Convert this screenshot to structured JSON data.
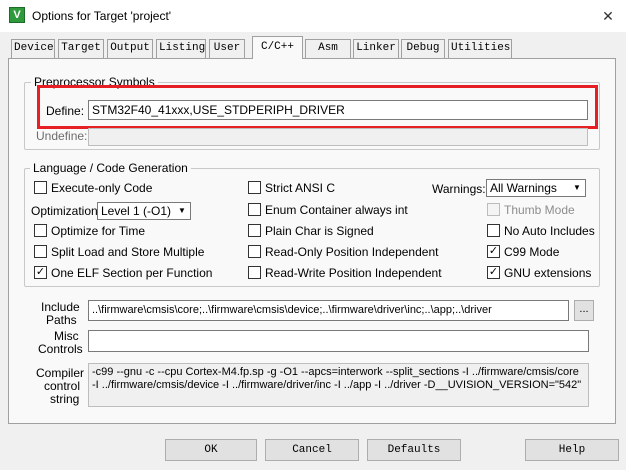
{
  "window": {
    "title": "Options for Target 'project'",
    "app_icon_glyph": "V",
    "close_glyph": "✕"
  },
  "tabs": [
    {
      "label": "Device"
    },
    {
      "label": "Target"
    },
    {
      "label": "Output"
    },
    {
      "label": "Listing"
    },
    {
      "label": "User"
    },
    {
      "label": "C/C++"
    },
    {
      "label": "Asm"
    },
    {
      "label": "Linker"
    },
    {
      "label": "Debug"
    },
    {
      "label": "Utilities"
    }
  ],
  "preprocessor": {
    "group_title": "Preprocessor Symbols",
    "define_label": "Define:",
    "define_value": "STM32F40_41xxx,USE_STDPERIPH_DRIVER",
    "undefine_label": "Undefine:",
    "undefine_value": ""
  },
  "codegen": {
    "group_title": "Language / Code Generation",
    "execute_only": {
      "label": "Execute-only Code",
      "checked": false
    },
    "optimization_label": "Optimization:",
    "optimization_value": "Level 1 (-O1)",
    "optimize_time": {
      "label": "Optimize for Time",
      "checked": false
    },
    "split_load": {
      "label": "Split Load and Store Multiple",
      "checked": false
    },
    "one_elf": {
      "label": "One ELF Section per Function",
      "checked": true
    },
    "strict_ansi": {
      "label": "Strict ANSI C",
      "checked": false
    },
    "enum_container": {
      "label": "Enum Container always int",
      "checked": false
    },
    "plain_char": {
      "label": "Plain Char is Signed",
      "checked": false
    },
    "ro_pi": {
      "label": "Read-Only Position Independent",
      "checked": false
    },
    "rw_pi": {
      "label": "Read-Write Position Independent",
      "checked": false
    },
    "warnings_label": "Warnings:",
    "warnings_value": "All Warnings",
    "thumb_mode": {
      "label": "Thumb Mode",
      "checked": false,
      "disabled": true
    },
    "no_auto_includes": {
      "label": "No Auto Includes",
      "checked": false
    },
    "c99_mode": {
      "label": "C99 Mode",
      "checked": true
    },
    "gnu_ext": {
      "label": "GNU extensions",
      "checked": true
    }
  },
  "paths": {
    "include_label_1": "Include",
    "include_label_2": "Paths",
    "include_value": "..\\firmware\\cmsis\\core;..\\firmware\\cmsis\\device;..\\firmware\\driver\\inc;..\\app;..\\driver",
    "browse_label": "...",
    "misc_label_1": "Misc",
    "misc_label_2": "Controls",
    "misc_value": "",
    "compiler_label_1": "Compiler",
    "compiler_label_2": "control",
    "compiler_label_3": "string",
    "compiler_value": "-c99 --gnu -c --cpu Cortex-M4.fp.sp -g -O1 --apcs=interwork --split_sections -I ../firmware/cmsis/core -I ../firmware/cmsis/device -I ../firmware/driver/inc -I ../app -I ../driver -D__UVISION_VERSION=\"542\""
  },
  "buttons": {
    "ok": "OK",
    "cancel": "Cancel",
    "defaults": "Defaults",
    "help": "Help"
  },
  "check_glyph": "✓",
  "colors": {
    "highlight": "#e51f24",
    "app_icon": "#2e9a3c"
  }
}
